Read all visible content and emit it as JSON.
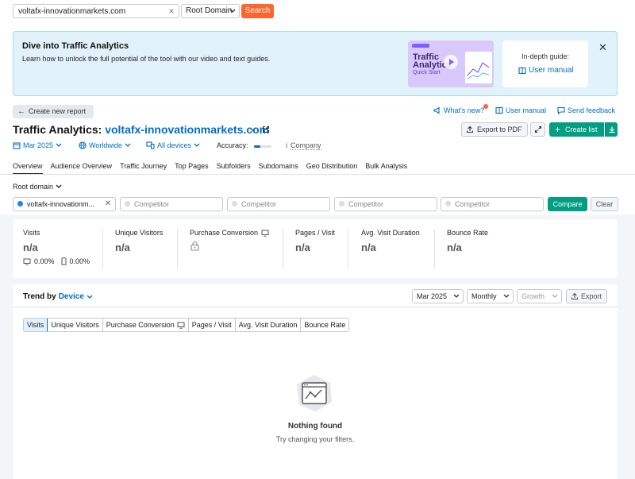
{
  "search": {
    "value": "voltafx-innovationmarkets.com",
    "domain_type": "Root Domain",
    "button": "Search"
  },
  "banner": {
    "title": "Dive into Traffic Analytics",
    "description": "Learn how to unlock the full potential of the tool with our video and text guides.",
    "thumb_line1": "Traffic",
    "thumb_line2": "Analytics",
    "thumb_sub": "Quick Start",
    "guide_label": "In-depth guide:",
    "guide_link": "User manual"
  },
  "header": {
    "create_report": "Create new report",
    "whats_new": "What's new?",
    "user_manual": "User manual",
    "send_feedback": "Send feedback",
    "title_prefix": "Traffic Analytics:",
    "domain": "voltafx-innovationmarkets.com",
    "export_pdf": "Export to PDF",
    "create_list": "Create list"
  },
  "filters": {
    "date": "Mar 2025",
    "region": "Worldwide",
    "devices": "All devices",
    "accuracy": "Accuracy:",
    "company": "Company"
  },
  "tabs": [
    "Overview",
    "Audience Overview",
    "Traffic Journey",
    "Top Pages",
    "Subfolders",
    "Subdomains",
    "Geo Distribution",
    "Bulk Analysis"
  ],
  "root_domain": "Root domain",
  "competitors": {
    "own": "voltafx-innovationm...",
    "placeholder": "Competitor",
    "compare": "Compare",
    "clear": "Clear"
  },
  "metrics": [
    {
      "label": "Visits",
      "value": "n/a"
    },
    {
      "label": "Unique Visitors",
      "value": "n/a"
    },
    {
      "label": "Purchase Conversion",
      "value": ""
    },
    {
      "label": "Pages / Visit",
      "value": "n/a"
    },
    {
      "label": "Avg. Visit Duration",
      "value": "n/a"
    },
    {
      "label": "Bounce Rate",
      "value": "n/a"
    }
  ],
  "device_share": {
    "desktop": "0.00%",
    "mobile": "0.00%"
  },
  "trend": {
    "title": "Trend by",
    "dimension": "Device",
    "date": "Mar 2025",
    "granularity": "Monthly",
    "mode": "Growth",
    "export": "Export",
    "metric_tabs": [
      "Visits",
      "Unique Visitors",
      "Purchase Conversion",
      "Pages / Visit",
      "Avg. Visit Duration",
      "Bounce Rate"
    ],
    "empty_title": "Nothing found",
    "empty_sub": "Try changing your filters."
  },
  "colors": {
    "accent": "#006dca",
    "search": "#ff642d",
    "primary_green": "#009f81",
    "banner_bg": "#e2f2fb"
  }
}
